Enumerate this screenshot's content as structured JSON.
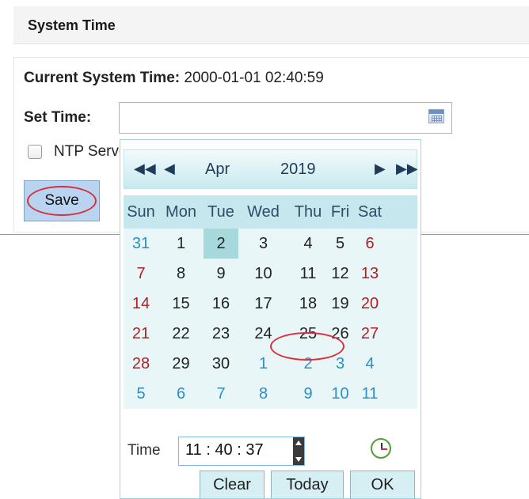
{
  "header": {
    "title": "System Time"
  },
  "current": {
    "label": "Current System Time:",
    "value": "2000-01-01 02:40:59"
  },
  "set_time": {
    "label": "Set Time:",
    "value": ""
  },
  "ntp": {
    "label": "NTP Server",
    "checked": false
  },
  "save_label": "Save",
  "picker": {
    "nav": {
      "prev_year": "◀◀",
      "prev_month": "◀",
      "next_month": "▶",
      "next_year": "▶▶"
    },
    "month": "Apr",
    "year": "2019",
    "weekdays": [
      "Sun",
      "Mon",
      "Tue",
      "Wed",
      "Thu",
      "Fri",
      "Sat"
    ],
    "weeks": [
      [
        "31",
        "1",
        "2",
        "3",
        "4",
        "5",
        "6"
      ],
      [
        "7",
        "8",
        "9",
        "10",
        "11",
        "12",
        "13"
      ],
      [
        "14",
        "15",
        "16",
        "17",
        "18",
        "19",
        "20"
      ],
      [
        "21",
        "22",
        "23",
        "24",
        "25",
        "26",
        "27"
      ],
      [
        "28",
        "29",
        "30",
        "1",
        "2",
        "3",
        "4"
      ],
      [
        "5",
        "6",
        "7",
        "8",
        "9",
        "10",
        "11"
      ]
    ],
    "selected_day": "2",
    "time_label": "Time",
    "time_value": "11 : 40 : 37",
    "buttons": {
      "clear": "Clear",
      "today": "Today",
      "ok": "OK"
    }
  },
  "colors": {
    "weekend": "#b02020",
    "other_month": "#2a8fc7",
    "selected_bg": "#a6d8dc",
    "header_bg": "#c5e7ed"
  }
}
